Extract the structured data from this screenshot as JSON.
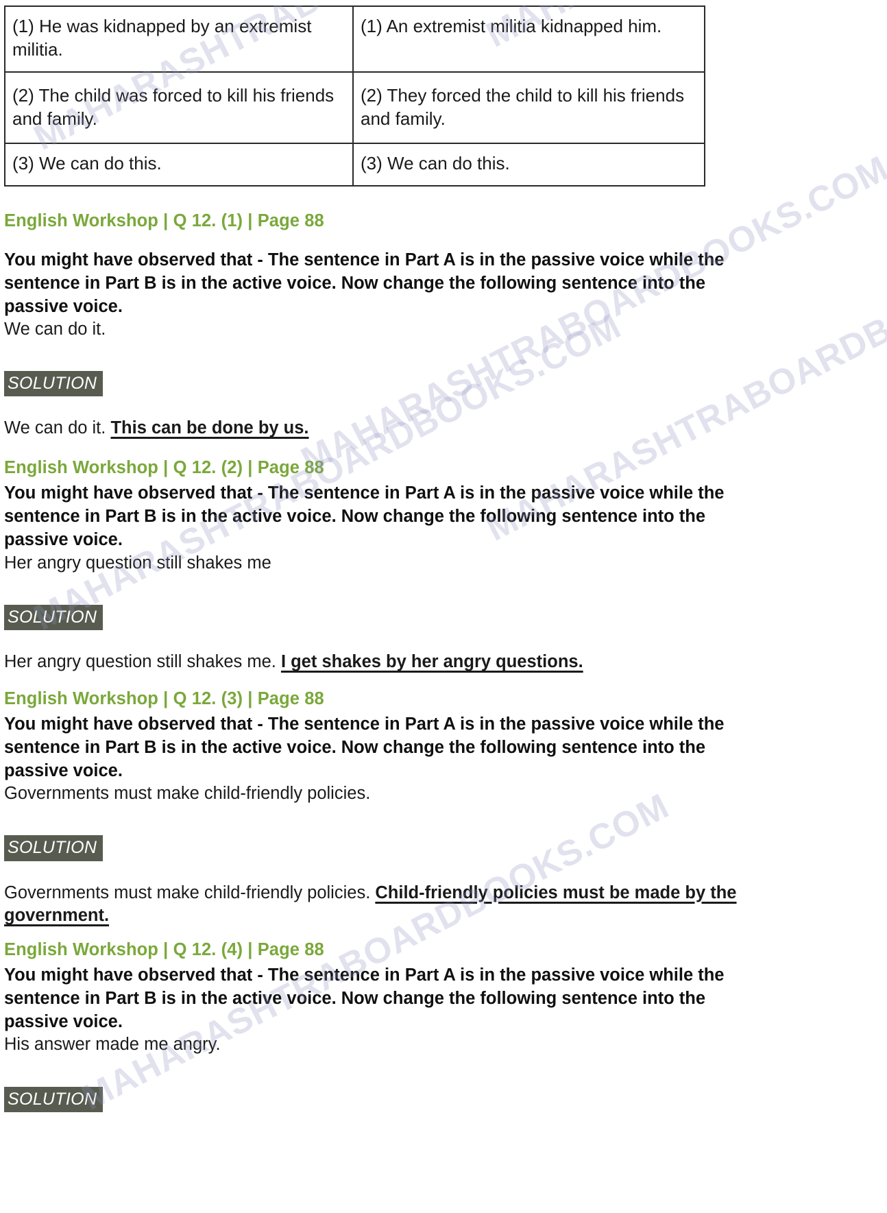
{
  "watermark": {
    "text": "MAHARASHTRABOARDBOOKS.COM"
  },
  "table": {
    "rows": [
      {
        "part_a": "(1) He was kidnapped by an extremist militia.",
        "part_b": "(1) An extremist militia kidnapped him."
      },
      {
        "part_a": "(2) The child was forced to kill his friends and family.",
        "part_b": "(2) They forced the child to kill his friends and family."
      },
      {
        "part_a": "(3) We can do this.",
        "part_b": "(3) We can do this."
      }
    ]
  },
  "blocks": [
    {
      "heading": "English Workshop | Q 12. (1) | Page 88",
      "prompt": "You might have observed that - The sentence in Part A is in the passive voice while the sentence in Part B is in the active voice. Now change the following sentence into the passive voice.",
      "sentence": "We can do it.",
      "solution_label": "SOLUTION",
      "answer_given": "We can do it. ",
      "answer_filled": "This can be done by us."
    },
    {
      "heading": "English Workshop | Q 12. (2) | Page 88",
      "prompt": "You might have observed that - The sentence in Part A is in the passive voice while the sentence in Part B is in the active voice. Now change the following sentence into the passive voice.",
      "sentence": "Her angry question still shakes me",
      "solution_label": "SOLUTION",
      "answer_given": "Her angry question still shakes me. ",
      "answer_filled": "I get shakes by her angry questions."
    },
    {
      "heading": "English Workshop | Q 12. (3) | Page 88",
      "prompt": "You might have observed that - The sentence in Part A is in the passive voice while the sentence in Part B is in the active voice. Now change the following sentence into the passive voice.",
      "sentence": "Governments must make child-friendly policies.",
      "solution_label": "SOLUTION",
      "answer_given": "Governments must make child-friendly policies. ",
      "answer_filled": "Child-friendly policies  must be made by the government."
    },
    {
      "heading": "English Workshop | Q 12. (4) | Page 88",
      "prompt": "You might have observed that - The sentence in Part A is in the passive voice while the sentence in Part B is in the active voice. Now change the following sentence into the passive voice.",
      "sentence": "His answer made me angry.",
      "solution_label": "SOLUTION"
    }
  ]
}
